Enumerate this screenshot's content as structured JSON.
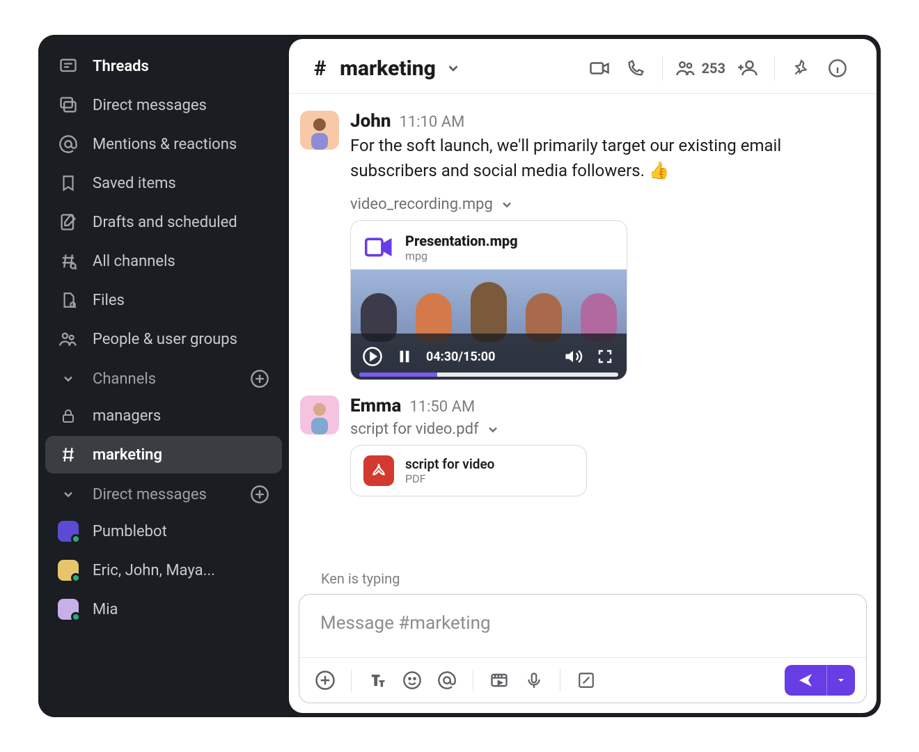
{
  "sidebar": {
    "nav": [
      {
        "label": "Threads"
      },
      {
        "label": "Direct messages"
      },
      {
        "label": "Mentions & reactions"
      },
      {
        "label": "Saved items"
      },
      {
        "label": "Drafts and scheduled"
      },
      {
        "label": "All channels"
      },
      {
        "label": "Files"
      },
      {
        "label": "People & user groups"
      }
    ],
    "channels_label": "Channels",
    "channels": [
      {
        "label": "managers",
        "locked": true,
        "active": false
      },
      {
        "label": "marketing",
        "locked": false,
        "active": true
      }
    ],
    "dm_label": "Direct messages",
    "dms": [
      {
        "label": "Pumblebot",
        "color": "#5b4bd4"
      },
      {
        "label": "Eric, John, Maya...",
        "color": "#e8c46b"
      },
      {
        "label": "Mia",
        "color": "#c7b0e8"
      }
    ]
  },
  "channel": {
    "hash": "#",
    "name": "marketing",
    "member_count": "253"
  },
  "messages": [
    {
      "user": "John",
      "time": "11:10 AM",
      "avatar_bg": "#f7c9a8",
      "text": "For the soft launch, we'll primarily target our existing email subscribers and social media followers. 👍",
      "attachment_label": "video_recording.mpg",
      "video": {
        "title": "Presentation.mpg",
        "subtype": "mpg",
        "time_elapsed": "04:30",
        "time_total": "15:00",
        "progress_percent": 30
      }
    },
    {
      "user": "Emma",
      "time": "11:50 AM",
      "avatar_bg": "#f5c3df",
      "pdf_label": "script for video.pdf",
      "pdf": {
        "title": "script for video",
        "subtype": "PDF"
      }
    }
  ],
  "typing": "Ken is typing",
  "composer": {
    "placeholder": "Message #marketing"
  }
}
